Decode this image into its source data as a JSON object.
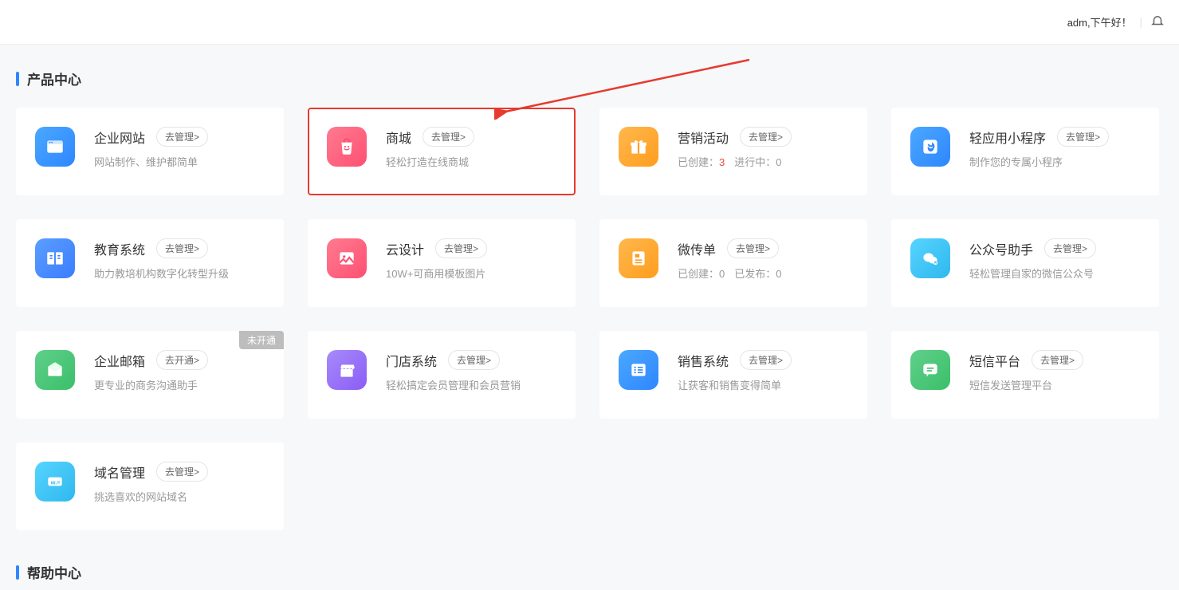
{
  "header": {
    "greeting": "adm,下午好！"
  },
  "sections": {
    "products_title": "产品中心",
    "help_title": "帮助中心"
  },
  "cards": {
    "website": {
      "title": "企业网站",
      "btn": "去管理>",
      "desc": "网站制作、维护都简单"
    },
    "mall": {
      "title": "商城",
      "btn": "去管理>",
      "desc": "轻松打造在线商城"
    },
    "marketing": {
      "title": "营销活动",
      "btn": "去管理>",
      "created_label": "已创建：",
      "created_count": "3",
      "progress_label": "进行中：",
      "progress_count": "0"
    },
    "miniapp": {
      "title": "轻应用小程序",
      "btn": "去管理>",
      "desc": "制作您的专属小程序"
    },
    "edu": {
      "title": "教育系统",
      "btn": "去管理>",
      "desc": "助力教培机构数字化转型升级"
    },
    "design": {
      "title": "云设计",
      "btn": "去管理>",
      "desc": "10W+可商用模板图片"
    },
    "flyer": {
      "title": "微传单",
      "btn": "去管理>",
      "created_label": "已创建：",
      "created_count": "0",
      "published_label": "已发布：",
      "published_count": "0"
    },
    "mp": {
      "title": "公众号助手",
      "btn": "去管理>",
      "desc": "轻松管理自家的微信公众号"
    },
    "email": {
      "title": "企业邮箱",
      "btn": "去开通>",
      "desc": "更专业的商务沟通助手",
      "badge": "未开通"
    },
    "store": {
      "title": "门店系统",
      "btn": "去管理>",
      "desc": "轻松搞定会员管理和会员营销"
    },
    "sales": {
      "title": "销售系统",
      "btn": "去管理>",
      "desc": "让获客和销售变得简单"
    },
    "sms": {
      "title": "短信平台",
      "btn": "去管理>",
      "desc": "短信发送管理平台"
    },
    "domain": {
      "title": "域名管理",
      "btn": "去管理>",
      "desc": "挑选喜欢的网站域名"
    }
  }
}
